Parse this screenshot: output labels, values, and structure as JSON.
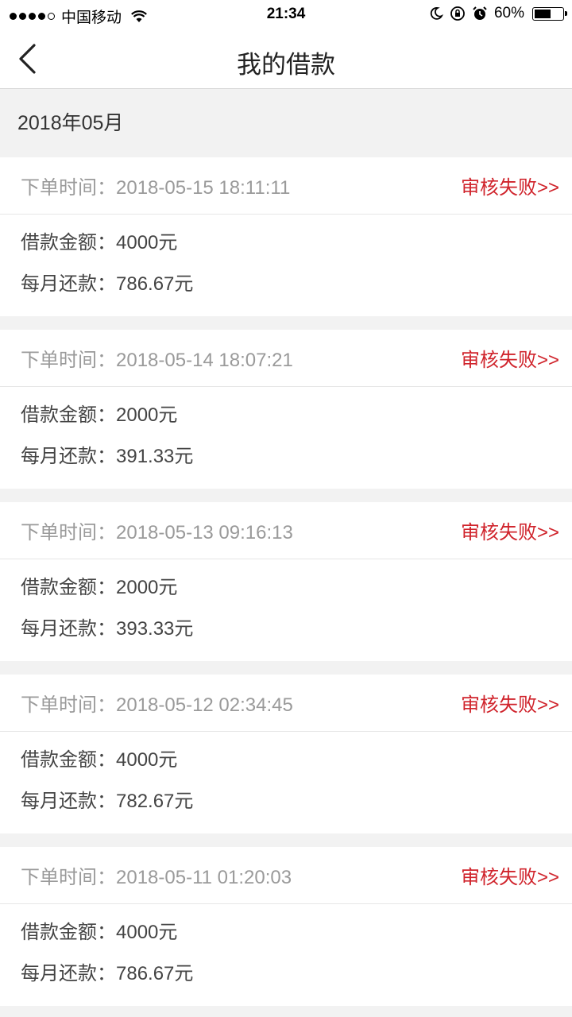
{
  "status_bar": {
    "carrier": "中国移动",
    "time": "21:34",
    "battery_percent": "60%",
    "battery_level": 0.6
  },
  "nav": {
    "title": "我的借款"
  },
  "month": "2018年05月",
  "labels": {
    "order_time": "下单时间：",
    "amount": "借款金额：",
    "monthly": "每月还款："
  },
  "loans": [
    {
      "time": "2018-05-15 18:11:11",
      "status": "审核失败>>",
      "amount": "4000元",
      "monthly": "786.67元"
    },
    {
      "time": "2018-05-14 18:07:21",
      "status": "审核失败>>",
      "amount": "2000元",
      "monthly": "391.33元"
    },
    {
      "time": "2018-05-13 09:16:13",
      "status": "审核失败>>",
      "amount": "2000元",
      "monthly": "393.33元"
    },
    {
      "time": "2018-05-12 02:34:45",
      "status": "审核失败>>",
      "amount": "4000元",
      "monthly": "782.67元"
    },
    {
      "time": "2018-05-11 01:20:03",
      "status": "审核失败>>",
      "amount": "4000元",
      "monthly": "786.67元"
    }
  ],
  "colors": {
    "status_red": "#d0242c",
    "background": "#f2f2f2"
  }
}
